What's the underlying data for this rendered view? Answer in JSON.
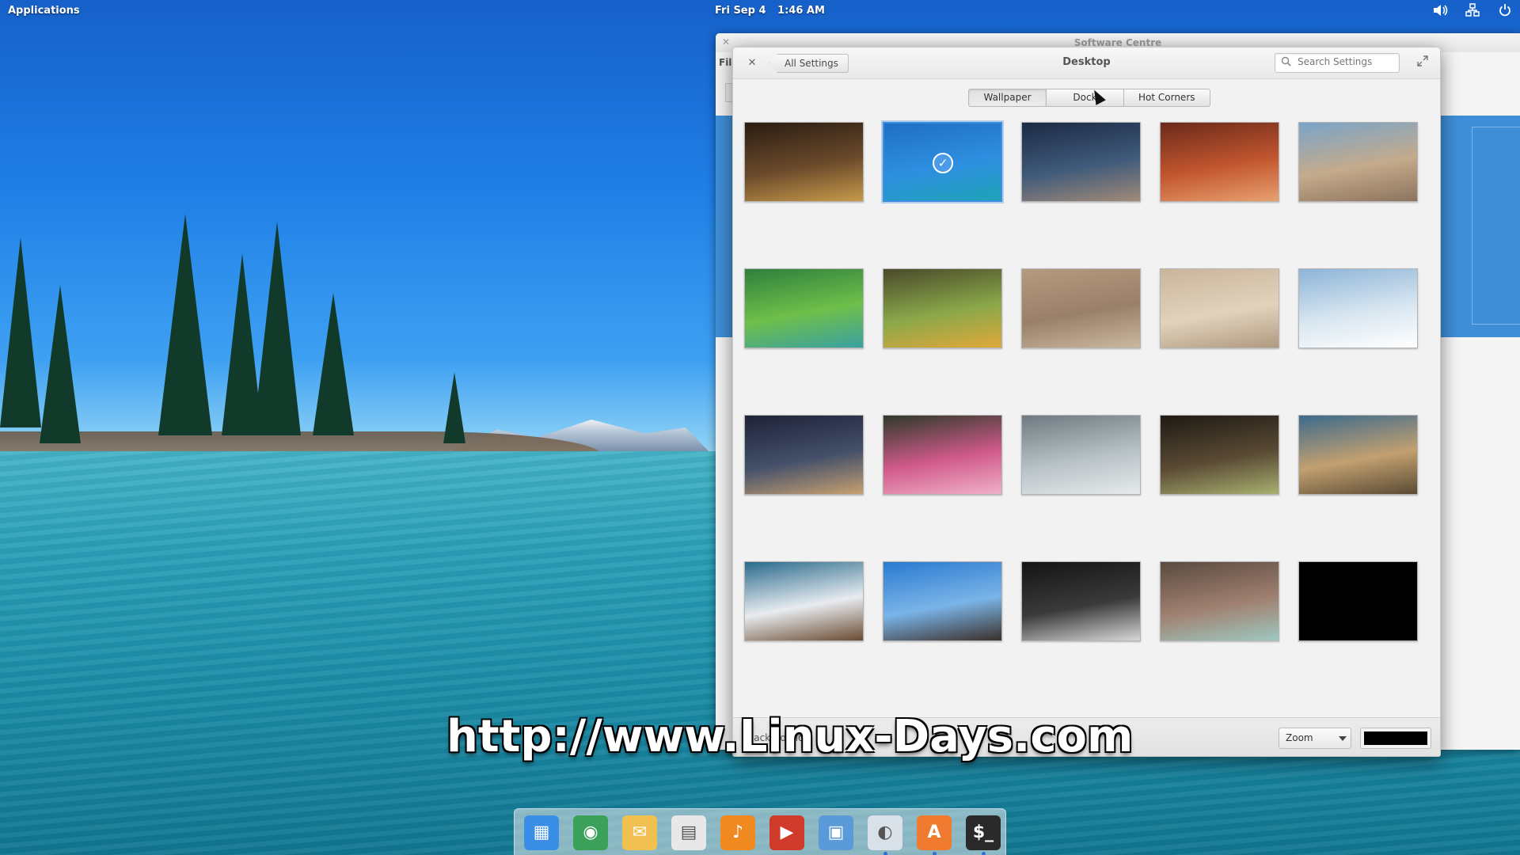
{
  "panel": {
    "applications_label": "Applications",
    "date": "Fri Sep 4",
    "time": "1:46 AM",
    "indicators": [
      "volume-icon",
      "network-icon",
      "power-icon"
    ]
  },
  "software_centre": {
    "title": "Software Centre",
    "menu_label": "File"
  },
  "settings": {
    "back_label": "All Settings",
    "title": "Desktop",
    "search_placeholder": "Search Settings",
    "tabs": [
      {
        "label": "Wallpaper",
        "active": true
      },
      {
        "label": "Dock",
        "active": false
      },
      {
        "label": "Hot Corners",
        "active": false
      }
    ],
    "wallpapers": [
      {
        "subject": "autumn leaves on wood",
        "colors": [
          "#2a1c12",
          "#6b4a2b",
          "#c79a4a"
        ],
        "selected": false
      },
      {
        "subject": "lake with trees",
        "colors": [
          "#1f6fc4",
          "#2e8fe0",
          "#1ea3b8"
        ],
        "selected": true
      },
      {
        "subject": "wooden pier over sea",
        "colors": [
          "#1c2a45",
          "#3f5a7a",
          "#a08a78"
        ],
        "selected": false
      },
      {
        "subject": "red canyon",
        "colors": [
          "#6b2a1a",
          "#c2562f",
          "#e8a070"
        ],
        "selected": false
      },
      {
        "subject": "rocks by the sea",
        "colors": [
          "#7aa4c8",
          "#c4ab8c",
          "#8c735c"
        ],
        "selected": false
      },
      {
        "subject": "green fern",
        "colors": [
          "#2f7f3e",
          "#6fbf4a",
          "#3aa1a0"
        ],
        "selected": false
      },
      {
        "subject": "flower in grass",
        "colors": [
          "#4a4a2a",
          "#8aa84a",
          "#e0a83a"
        ],
        "selected": false
      },
      {
        "subject": "shell on sand",
        "colors": [
          "#b59a80",
          "#9a8068",
          "#cbb7a0"
        ],
        "selected": false
      },
      {
        "subject": "sand dunes",
        "colors": [
          "#c9b59a",
          "#e2d2bc",
          "#b09a80"
        ],
        "selected": false
      },
      {
        "subject": "clouds",
        "colors": [
          "#8cb4d8",
          "#d8e6f0",
          "#ffffff"
        ],
        "selected": false
      },
      {
        "subject": "dusk sky",
        "colors": [
          "#1e2238",
          "#44506a",
          "#c6a070"
        ],
        "selected": false
      },
      {
        "subject": "pink lotus",
        "colors": [
          "#2e3a2a",
          "#d05a8a",
          "#f0b0c8"
        ],
        "selected": false
      },
      {
        "subject": "grey fabric texture",
        "colors": [
          "#6e7a80",
          "#b8c2c6",
          "#e6eaec"
        ],
        "selected": false
      },
      {
        "subject": "tunnel",
        "colors": [
          "#1e1a14",
          "#5a4a34",
          "#a8b070"
        ],
        "selected": false
      },
      {
        "subject": "fence by the coast",
        "colors": [
          "#3c6a8c",
          "#c2a070",
          "#5a4a34"
        ],
        "selected": false
      },
      {
        "subject": "snowy mountains",
        "colors": [
          "#2a6a8c",
          "#e8ecf0",
          "#6a4a30"
        ],
        "selected": false
      },
      {
        "subject": "eiffel tower",
        "colors": [
          "#2a7ad0",
          "#7ab4e8",
          "#3a3028"
        ],
        "selected": false
      },
      {
        "subject": "hanging lamp",
        "colors": [
          "#141414",
          "#3a3a3a",
          "#d8d8d8"
        ],
        "selected": false
      },
      {
        "subject": "succulent plants",
        "colors": [
          "#5a4a40",
          "#a08070",
          "#9ec8c0"
        ],
        "selected": false
      },
      {
        "subject": "solid black",
        "colors": [
          "#000000",
          "#000000",
          "#000000"
        ],
        "selected": false
      }
    ],
    "bottom": {
      "left_label": "Backgrounds",
      "zoom_label": "Zoom",
      "color": "#000000"
    }
  },
  "watermark": "http://www.Linux-Days.com",
  "dock": {
    "apps": [
      {
        "name": "multitasking-view-icon",
        "color": "#3a8ee6"
      },
      {
        "name": "browser-icon",
        "color": "#3aa05a"
      },
      {
        "name": "mail-icon",
        "color": "#f0c050"
      },
      {
        "name": "calendar-icon",
        "color": "#e8e8e8"
      },
      {
        "name": "music-icon",
        "color": "#f08a20"
      },
      {
        "name": "videos-icon",
        "color": "#d03a2a"
      },
      {
        "name": "photos-icon",
        "color": "#5a9ad8"
      },
      {
        "name": "settings-icon",
        "color": "#d8e0e8"
      },
      {
        "name": "app-center-icon",
        "color": "#f07a30"
      },
      {
        "name": "terminal-icon",
        "color": "#2a2a2a"
      }
    ]
  }
}
